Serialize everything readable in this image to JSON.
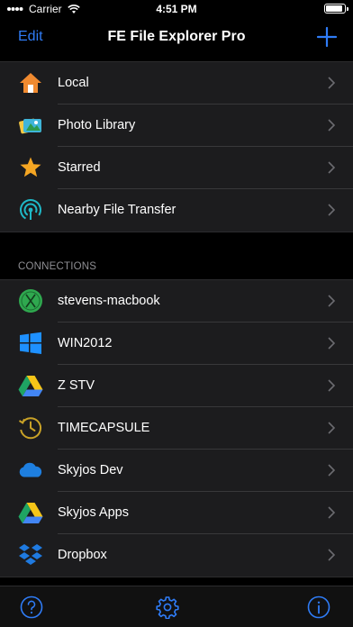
{
  "status_bar": {
    "carrier": "Carrier",
    "time": "4:51 PM"
  },
  "nav": {
    "edit_label": "Edit",
    "title": "FE File Explorer Pro",
    "add_icon": "plus-icon"
  },
  "places": [
    {
      "label": "Local",
      "icon": "home-icon"
    },
    {
      "label": "Photo Library",
      "icon": "photo-library-icon"
    },
    {
      "label": "Starred",
      "icon": "star-icon"
    },
    {
      "label": "Nearby File Transfer",
      "icon": "nearby-transfer-icon"
    }
  ],
  "connections_header": "CONNECTIONS",
  "connections": [
    {
      "label": "stevens-macbook",
      "icon": "macbook-icon"
    },
    {
      "label": "WIN2012",
      "icon": "windows-icon"
    },
    {
      "label": "Z STV",
      "icon": "google-drive-icon"
    },
    {
      "label": "TIMECAPSULE",
      "icon": "time-capsule-icon"
    },
    {
      "label": "Skyjos Dev",
      "icon": "onedrive-icon"
    },
    {
      "label": "Skyjos Apps",
      "icon": "google-drive-icon"
    },
    {
      "label": "Dropbox",
      "icon": "dropbox-icon"
    }
  ],
  "tab_bar": [
    {
      "icon": "help-icon"
    },
    {
      "icon": "settings-icon"
    },
    {
      "icon": "info-icon"
    }
  ],
  "colors": {
    "accent": "#2f7cf6",
    "background": "#000000",
    "row_bg": "#1c1c1e",
    "secondary_text": "#8e8e93"
  }
}
